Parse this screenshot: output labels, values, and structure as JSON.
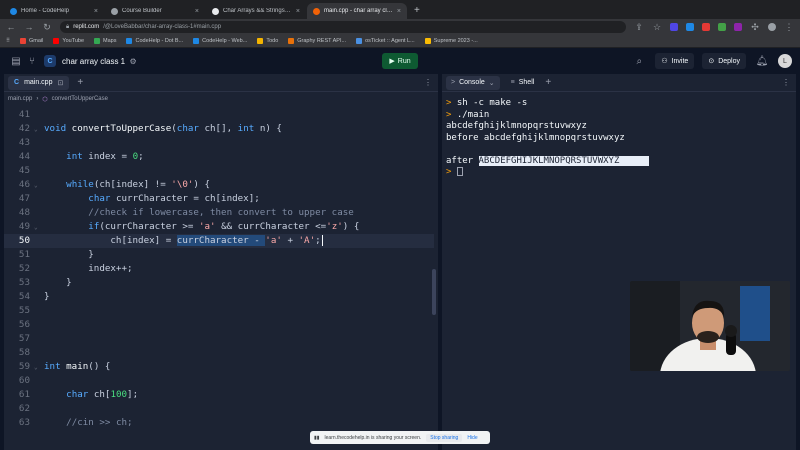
{
  "browser": {
    "tabs": [
      {
        "label": "Home - CodeHelp",
        "color": "#1e88e5",
        "active": false
      },
      {
        "label": "Course Builder",
        "color": "#9aa0a6",
        "active": false
      },
      {
        "label": "Char Arrays && Strings - L",
        "color": "#e8eaed",
        "active": false
      },
      {
        "label": "main.cpp - char array class 1 -",
        "color": "#f26207",
        "active": true
      }
    ],
    "new_tab": "+",
    "url_host": "replit.com",
    "url_path": "/@LoveBabbar/char-array-class-1#main.cpp",
    "bookmarks": [
      {
        "label": "Gmail",
        "color": "#ea4335"
      },
      {
        "label": "YouTube",
        "color": "#ff0000"
      },
      {
        "label": "Maps",
        "color": "#34a853"
      },
      {
        "label": "CodeHelp - Dot B...",
        "color": "#1e88e5"
      },
      {
        "label": "CodeHelp - Web...",
        "color": "#1e88e5"
      },
      {
        "label": "Todo",
        "color": "#f4b400"
      },
      {
        "label": "Graphy REST API...",
        "color": "#e8710a"
      },
      {
        "label": "osTicket :: Agent L...",
        "color": "#4a90e2"
      },
      {
        "label": "Supreme 2023 -...",
        "color": "#fbbc04"
      }
    ]
  },
  "replit": {
    "repl_logo": "C",
    "repl_name": "char array class 1",
    "run_label": "Run",
    "invite_label": "Invite",
    "deploy_label": "Deploy",
    "avatar_letter": "L"
  },
  "editor": {
    "tab_label": "main.cpp",
    "tab_logo": "C",
    "breadcrumb": [
      "main.cpp",
      "convertToUpperCase"
    ],
    "current_line": 50,
    "lines": [
      {
        "n": "41",
        "fold": "",
        "tokens": []
      },
      {
        "n": "42",
        "fold": "v",
        "tokens": [
          [
            "kw",
            "void "
          ],
          [
            "fn",
            "convertToUpperCase"
          ],
          [
            "",
            "("
          ],
          [
            "kw",
            "char"
          ],
          [
            "",
            " ch[], "
          ],
          [
            "kw",
            "int"
          ],
          [
            "",
            " n) {"
          ]
        ]
      },
      {
        "n": "43",
        "fold": "",
        "tokens": []
      },
      {
        "n": "44",
        "fold": "",
        "tokens": [
          [
            "",
            " "
          ],
          [
            "kw",
            "int"
          ],
          [
            "",
            " index = "
          ],
          [
            "num",
            "0"
          ],
          [
            "",
            ";"
          ]
        ]
      },
      {
        "n": "45",
        "fold": "",
        "tokens": []
      },
      {
        "n": "46",
        "fold": "v",
        "tokens": [
          [
            "",
            " "
          ],
          [
            "kw",
            "while"
          ],
          [
            "",
            "(ch[index] != "
          ],
          [
            "chr",
            "'\\0'"
          ],
          [
            "",
            ") {"
          ]
        ]
      },
      {
        "n": "47",
        "fold": "",
        "tokens": [
          [
            "",
            " "
          ],
          [
            "kw",
            "char"
          ],
          [
            "",
            " currCharacter = ch[index];"
          ]
        ]
      },
      {
        "n": "48",
        "fold": "",
        "tokens": [
          [
            "",
            " "
          ],
          [
            "cmt",
            "//check if lowercase, then convert to upper case"
          ]
        ]
      },
      {
        "n": "49",
        "fold": "v",
        "tokens": [
          [
            "",
            " "
          ],
          [
            "kw",
            "if"
          ],
          [
            "",
            "(currCharacter >= "
          ],
          [
            "chr",
            "'a'"
          ],
          [
            "",
            " && currCharacter <="
          ],
          [
            "chr",
            "'z'"
          ],
          [
            "",
            ") {"
          ]
        ]
      },
      {
        "n": "50",
        "fold": "",
        "tokens": [
          [
            "",
            " ch[index] = "
          ],
          [
            "sel",
            "currCharacter - "
          ],
          [
            "chr",
            "'a'"
          ],
          [
            "",
            " + "
          ],
          [
            "chr",
            "'A'"
          ],
          [
            "",
            ";"
          ]
        ]
      },
      {
        "n": "51",
        "fold": "",
        "tokens": [
          [
            "",
            " }"
          ]
        ]
      },
      {
        "n": "52",
        "fold": "",
        "tokens": [
          [
            "",
            " index++;"
          ]
        ]
      },
      {
        "n": "53",
        "fold": "",
        "tokens": [
          [
            "",
            " }"
          ]
        ]
      },
      {
        "n": "54",
        "fold": "",
        "tokens": [
          [
            "",
            "}"
          ]
        ]
      },
      {
        "n": "55",
        "fold": "",
        "tokens": []
      },
      {
        "n": "56",
        "fold": "",
        "tokens": []
      },
      {
        "n": "57",
        "fold": "",
        "tokens": []
      },
      {
        "n": "58",
        "fold": "",
        "tokens": []
      },
      {
        "n": "59",
        "fold": "v",
        "tokens": [
          [
            "kw",
            "int "
          ],
          [
            "fn",
            "main"
          ],
          [
            "",
            "() {"
          ]
        ]
      },
      {
        "n": "60",
        "fold": "",
        "tokens": []
      },
      {
        "n": "61",
        "fold": "",
        "tokens": [
          [
            "",
            " "
          ],
          [
            "kw",
            "char"
          ],
          [
            "",
            " ch["
          ],
          [
            "num",
            "100"
          ],
          [
            "",
            "];"
          ]
        ]
      },
      {
        "n": "62",
        "fold": "",
        "tokens": []
      },
      {
        "n": "63",
        "fold": "",
        "tokens": [
          [
            "",
            " "
          ],
          [
            "cmt",
            "//cin >> ch;"
          ]
        ]
      }
    ]
  },
  "console": {
    "tabs": [
      {
        "label": "Console",
        "icon": ">",
        "active": true
      },
      {
        "label": "Shell",
        "icon": "≡",
        "active": false
      }
    ],
    "output": [
      {
        "prompt": ">",
        "text": " sh -c make -s",
        "highlight": ""
      },
      {
        "prompt": ">",
        "text": " ./main",
        "highlight": ""
      },
      {
        "prompt": "",
        "text": "abcdefghijklmnopqrstuvwxyz",
        "highlight": ""
      },
      {
        "prompt": "",
        "text": "before abcdefghijklmnopqrstuvwxyz",
        "highlight": ""
      },
      {
        "prompt": "",
        "text": "",
        "highlight": ""
      },
      {
        "prompt": "",
        "text": "after ",
        "highlight": "ABCDEFGHIJKLMNOPQRSTUVWXYZ"
      },
      {
        "prompt": ">",
        "text": " ",
        "highlight": "",
        "cursor": true
      }
    ]
  },
  "share_bar": {
    "message": "learn.thecodehelp.in is sharing your screen.",
    "stop_label": "Stop sharing",
    "hide_label": "Hide"
  }
}
